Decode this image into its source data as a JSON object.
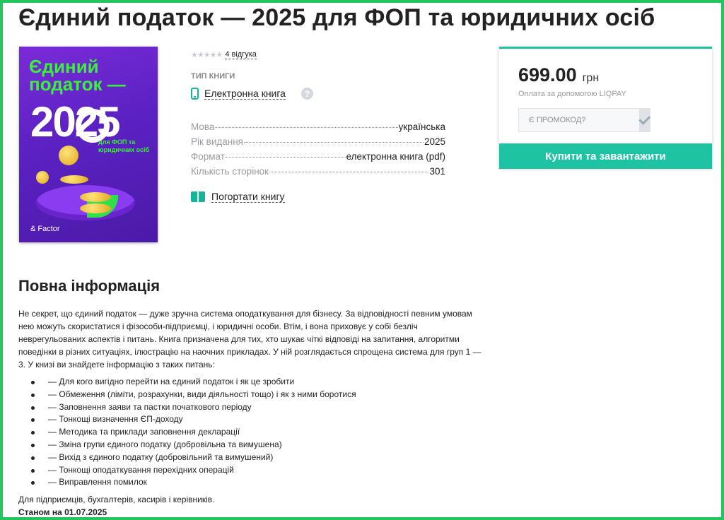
{
  "page": {
    "title": "Єдиний податок — 2025 для ФОП та юридичних осіб",
    "accent_color": "#1dc3a3",
    "frame_color": "#22c55e"
  },
  "cover": {
    "line1": "Єдиний",
    "line2": "податок —",
    "year": "2025",
    "subtitle_prefix": "для ",
    "subtitle_highlight": "ФОП",
    "subtitle_rest": " та юридичних осіб",
    "publisher": "& Factor"
  },
  "rating": {
    "stars_icon": "star-icon",
    "stars_filled": 0,
    "stars_total": 5,
    "reviews_label": "4 відгука"
  },
  "book_type": {
    "label": "ТИП КНИГИ",
    "icon": "phone-icon",
    "value": "Електронна книга",
    "help_icon": "question-icon"
  },
  "properties": [
    {
      "key": "Мова",
      "value": "українська"
    },
    {
      "key": "Рік видання",
      "value": "2025"
    },
    {
      "key": "Формат",
      "value": "електронна книга (pdf)"
    },
    {
      "key": "Кількість сторінок",
      "value": "301"
    }
  ],
  "preview": {
    "icon": "book-open-icon",
    "label": "Погортати книгу"
  },
  "buy": {
    "price": "699.00",
    "currency": "грн",
    "payment_note": "Оплата за допомогою LIQPAY",
    "promo_placeholder": "Є ПРОМОКОД?",
    "promo_apply_icon": "check-icon",
    "buy_label": "Купити та завантажити"
  },
  "info": {
    "title": "Повна інформація",
    "description": "Не секрет, що єдиний податок — дуже зручна система оподаткування для бізнесу. За відповідності певним умовам нею можуть скористатися і фізособи-підприємці, і юридичні особи. Втім, і вона приховує у собі безліч неврегульованих аспектів і питань. Книга призначена для тих, хто шукає чіткі відповіді на запитання, алгоритми поведінки в різних ситуаціях, ілюстрацію на наочних прикладах. У ній розглядається спрощена система для груп 1 — 3. У книзі ви знайдете інформацію з таких питань:",
    "topics": [
      "— Для кого вигідно перейти на єдиний податок і як це зробити",
      "— Обмеження (ліміти, розрахунки, види діяльності тощо) і як з ними боротися",
      "— Заповнення заяви та пастки початкового періоду",
      "— Тонкощі визначення ЄП-доходу",
      "— Методика та приклади заповнення декларації",
      "— Зміна групи єдиного податку (добровільна та вимушена)",
      "— Вихід з єдиного податку (добровільний та вимушений)",
      "— Тонкощі оподаткування перехідних операцій",
      "— Виправлення помилок"
    ],
    "audience": "Для підприємців, бухгалтерів, касирів і керівників.",
    "as_of": "Станом на 01.07.2025"
  }
}
